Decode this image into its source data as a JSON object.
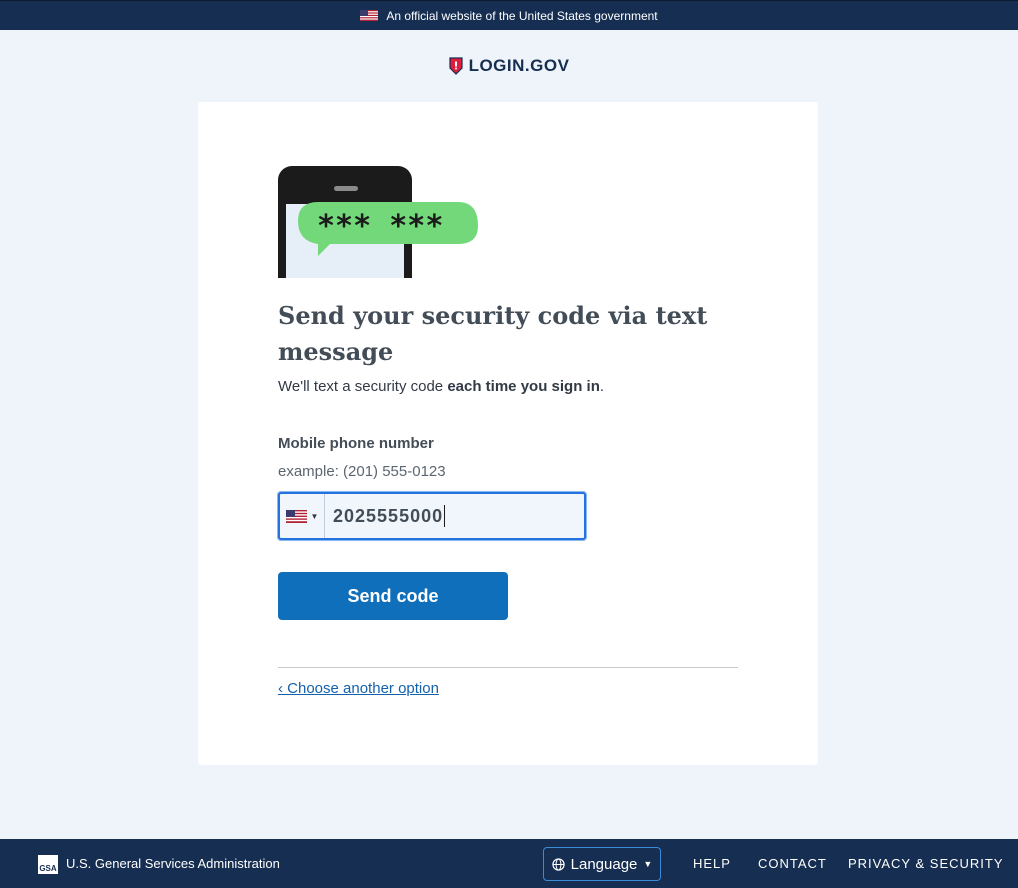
{
  "banner": {
    "text": "An official website of the United States government",
    "flag_icon": "us-flag-icon"
  },
  "brand": {
    "name": "LOGIN.GOV",
    "icon": "shield-icon",
    "color": "#162e51",
    "accent": "#e21c3d"
  },
  "illustration": {
    "code_bubble": "*** ***",
    "bubble_color": "#72d87a"
  },
  "main": {
    "title": "Send your security code via text message",
    "subtitle_prefix": "We'll text a security code ",
    "subtitle_bold": "each time you sign in",
    "subtitle_suffix": "."
  },
  "phone": {
    "label": "Mobile phone number",
    "hint": "example: (201) 555-0123",
    "country": "us-flag-icon",
    "value": "2025555000"
  },
  "actions": {
    "send_label": "Send code",
    "alt_link": "‹ Choose another option",
    "primary_color": "#0f6fbb"
  },
  "footer": {
    "agency": "U.S. General Services Administration",
    "gsa_mark": "GSA",
    "language_label": "Language",
    "help": "HELP",
    "contact": "CONTACT",
    "privacy": "PRIVACY & SECURITY"
  }
}
